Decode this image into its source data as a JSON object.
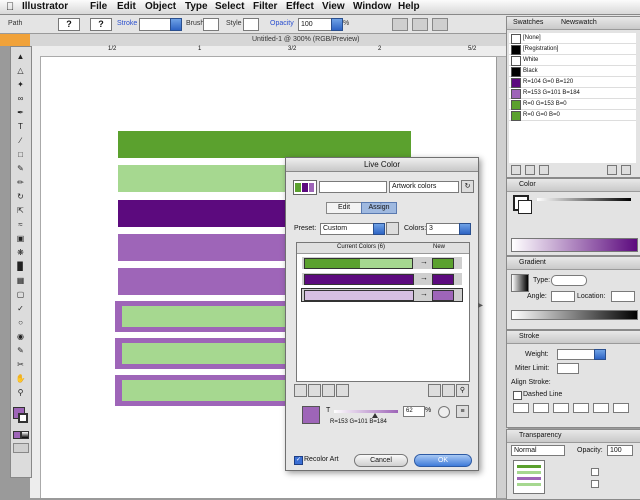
{
  "menubar": {
    "app": "Illustrator",
    "items": [
      "File",
      "Edit",
      "Object",
      "Type",
      "Select",
      "Filter",
      "Effect",
      "View",
      "Window",
      "Help"
    ]
  },
  "control_bar": {
    "path_label": "Path",
    "stroke_label": "Stroke",
    "brush_label": "Brush",
    "style_label": "Style",
    "opacity_label": "Opacity",
    "opacity_value": "100",
    "pct": "%"
  },
  "document": {
    "tab_title": "Untitled-1 @ 300% (RGB/Preview)"
  },
  "ruler": {
    "marks": [
      "1/2",
      "1",
      "3/2",
      "2",
      "5/2"
    ]
  },
  "artwork": {
    "colors": {
      "dark_green": "#5ba12e",
      "light_green": "#a6d890",
      "dark_purple": "#5c0a7e",
      "mid_purple": "#9e65b8",
      "frame_purple": "#9e65b8"
    }
  },
  "swatches_panel": {
    "tabs": [
      "Swatches",
      "Newswatch"
    ],
    "rows": [
      {
        "name": "[None]",
        "color": "#ffffff"
      },
      {
        "name": "[Registration]",
        "color": "#000000"
      },
      {
        "name": "White",
        "color": "#ffffff"
      },
      {
        "name": "Black",
        "color": "#000000"
      },
      {
        "name": "R=104 G=0 B=120",
        "color": "#5c0a7e"
      },
      {
        "name": "R=153 G=101 B=184",
        "color": "#9e65b8"
      },
      {
        "name": "R=0 G=153 B=0",
        "color": "#5ba12e"
      },
      {
        "name": "R=0 G=0 B=0",
        "color": "#5ba12e"
      }
    ]
  },
  "color_panel": {
    "title": "Color"
  },
  "gradient_panel": {
    "title": "Gradient",
    "type_label": "Type:",
    "angle_label": "Angle:",
    "location_label": "Location:"
  },
  "stroke_panel": {
    "title": "Stroke",
    "weight_label": "Weight:",
    "miter_label": "Miter Limit:",
    "align_label": "Align Stroke:",
    "dashed_label": "Dashed Line"
  },
  "transparency_panel": {
    "title": "Transparency",
    "mode": "Normal",
    "opacity_label": "Opacity:",
    "opacity_value": "100"
  },
  "live_color": {
    "title": "Live Color",
    "harmony_name": "Artwork colors",
    "tabs": [
      "Edit",
      "Assign"
    ],
    "preset_label": "Preset:",
    "preset_value": "Custom",
    "colors_label": "Colors:",
    "colors_value": "3",
    "col_current": "Current Colors (6)",
    "col_new": "New",
    "rows": [
      {
        "current_a": "#5ba12e",
        "current_b": "#a6d890",
        "new": "#5ba12e"
      },
      {
        "current_a": "#5c0a7e",
        "current_b": "#5c0a7e",
        "new": "#5c0a7e"
      },
      {
        "current_a": "#d6bfe2",
        "current_b": "#d6bfe2",
        "new": "#9e65b8"
      }
    ],
    "slider_label": "T",
    "slider_value": "62",
    "pct": "%",
    "rgb_readout": "R=153 G=101 B=184",
    "recolor_label": "Recolor Art",
    "cancel_label": "Cancel",
    "ok_label": "OK"
  }
}
